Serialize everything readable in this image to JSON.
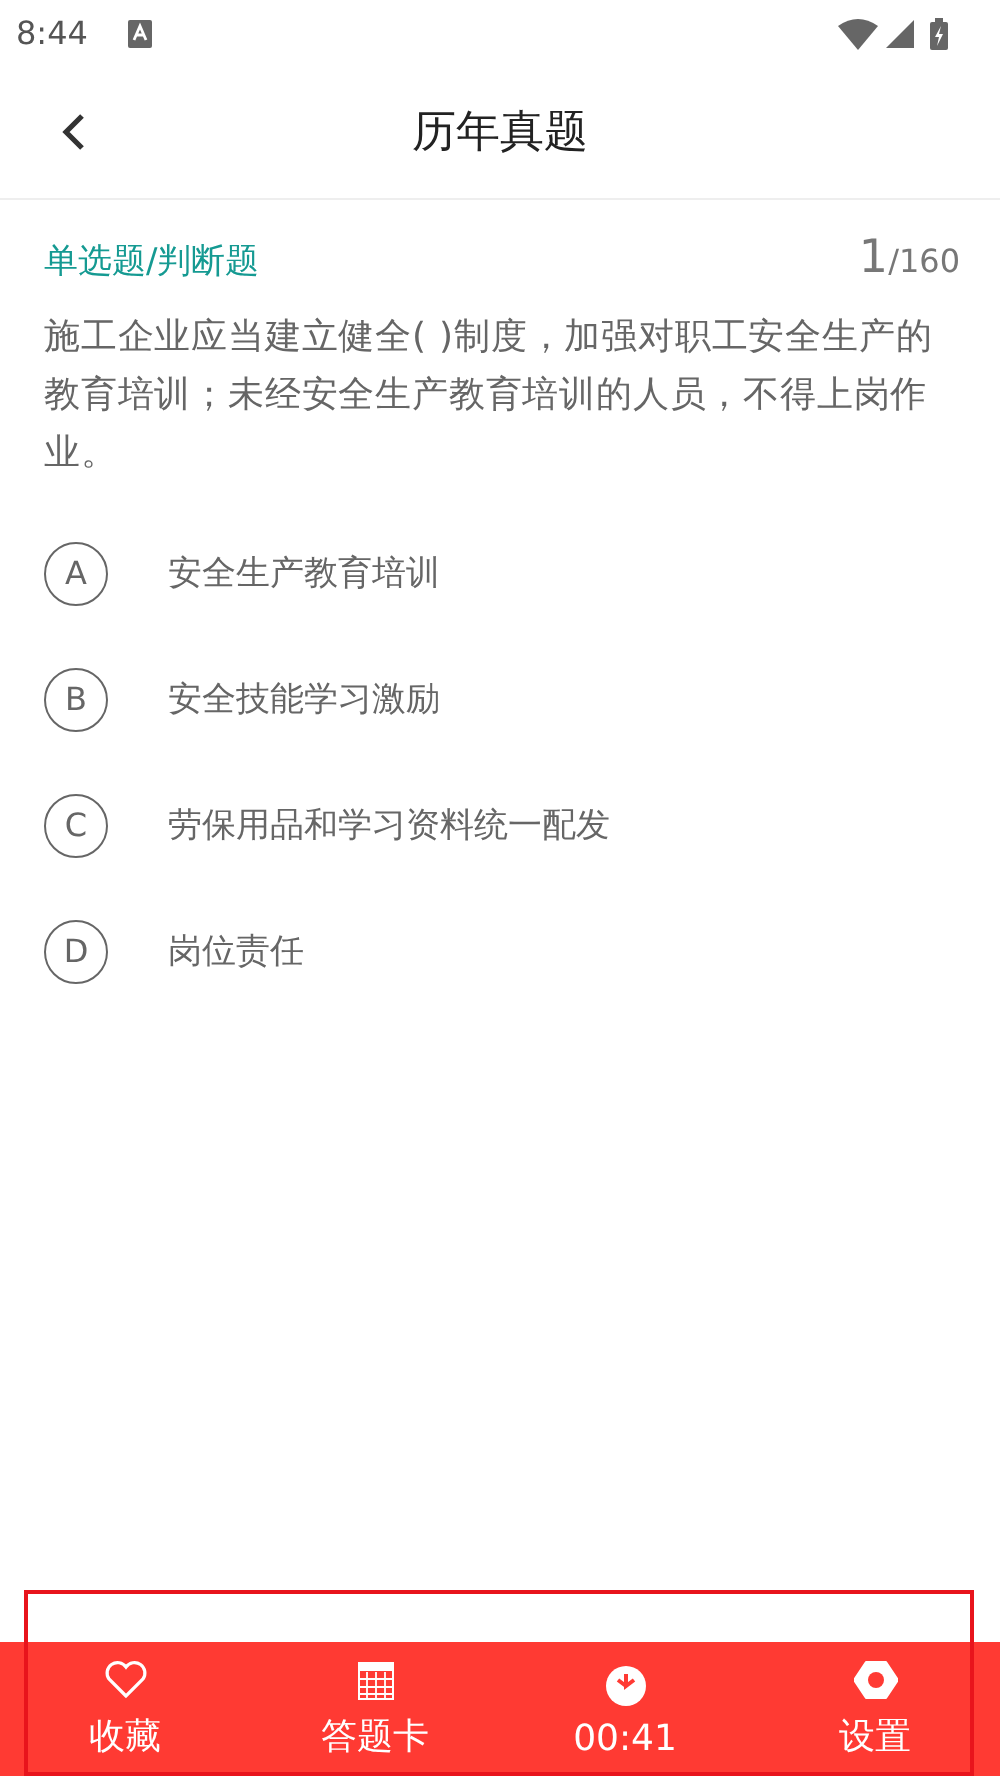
{
  "status_bar": {
    "time": "8:44"
  },
  "header": {
    "title": "历年真题"
  },
  "question": {
    "type": "单选题/判断题",
    "current": "1",
    "total": "/160",
    "text": "施工企业应当建立健全( )制度，加强对职工安全生产的教育培训；未经安全生产教育培训的人员，不得上岗作业。",
    "options": [
      {
        "letter": "A",
        "text": "安全生产教育培训",
        "selected": false
      },
      {
        "letter": "B",
        "text": "安全技能学习激励",
        "selected": false
      },
      {
        "letter": "C",
        "text": "劳保用品和学习资料统一配发",
        "selected": false
      },
      {
        "letter": "D",
        "text": "岗位责任",
        "selected": false
      }
    ]
  },
  "bottom_bar": [
    {
      "kind": "favorite",
      "label": "收藏"
    },
    {
      "kind": "card",
      "label": "答题卡"
    },
    {
      "kind": "timer",
      "label": "00:41"
    },
    {
      "kind": "settings",
      "label": "设置"
    }
  ]
}
